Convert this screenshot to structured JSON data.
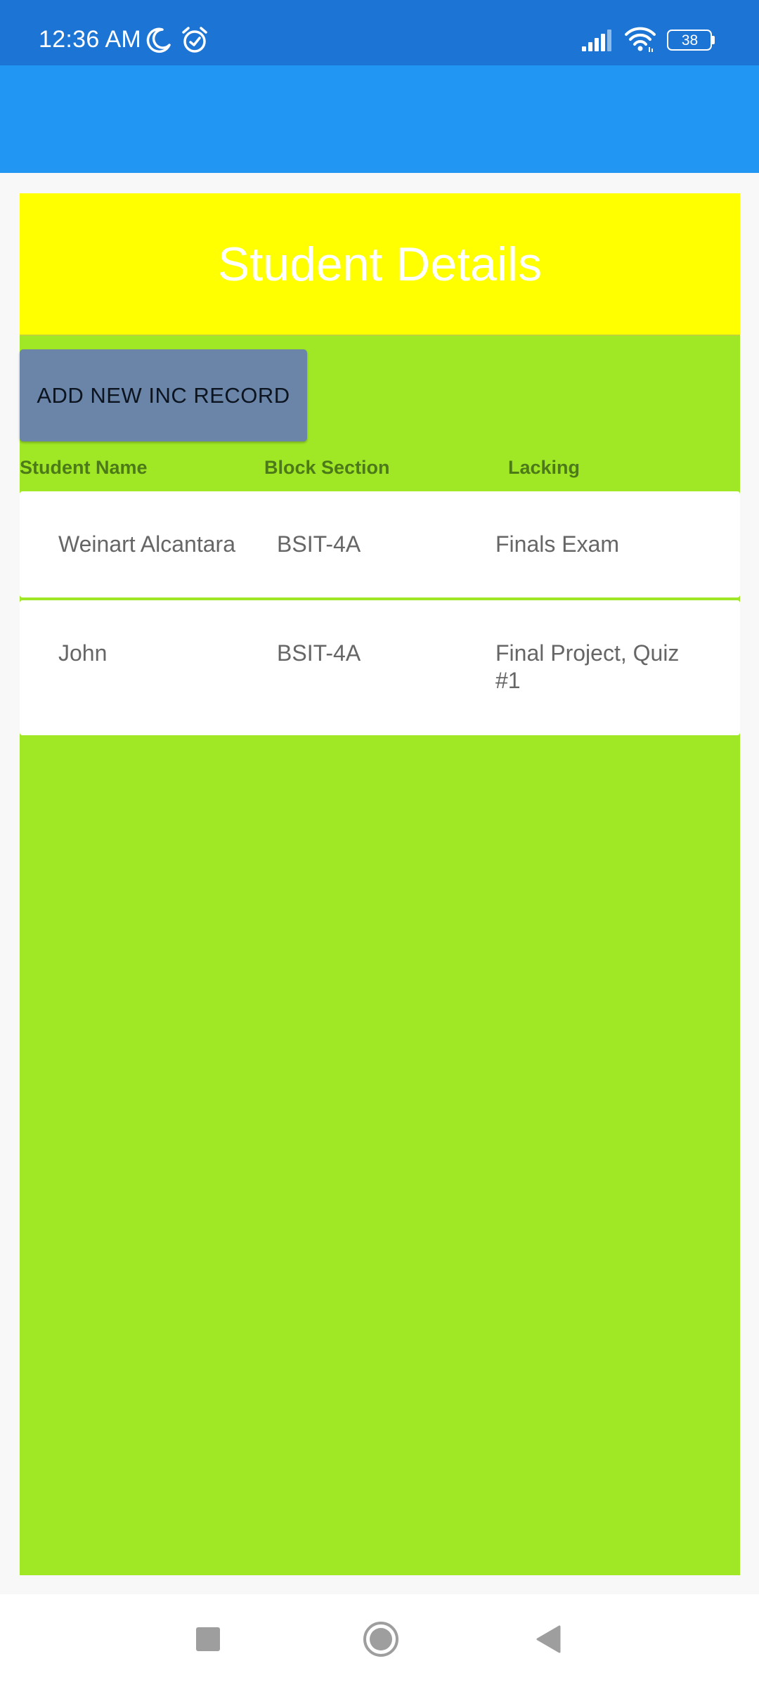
{
  "status_bar": {
    "time": "12:36 AM",
    "battery": "38",
    "icons": [
      "moon-icon",
      "alarm-icon",
      "signal-icon",
      "wifi-icon",
      "battery-icon"
    ]
  },
  "header": {
    "title": "Student Details"
  },
  "actions": {
    "add_button": "ADD NEW INC RECORD"
  },
  "table": {
    "columns": [
      "Student Name",
      "Block Section",
      "Lacking"
    ],
    "rows": [
      {
        "name": "Weinart Alcantara",
        "section": "BSIT-4A",
        "lacking": "Finals Exam"
      },
      {
        "name": "John",
        "section": "BSIT-4A",
        "lacking": "Final Project, Quiz #1"
      }
    ]
  },
  "nav_bar": {
    "icons": [
      "recents-icon",
      "home-icon",
      "back-icon"
    ]
  },
  "colors": {
    "status_bar": "#1c74d4",
    "app_bar": "#2196f3",
    "header_banner": "#ffff00",
    "content_background": "#a0e826",
    "button": "#6a85a8",
    "column_header_text": "#4d7a18"
  }
}
